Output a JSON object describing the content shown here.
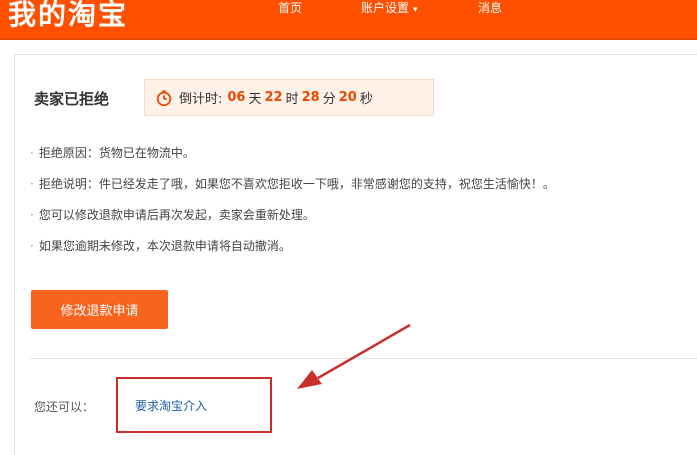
{
  "header": {
    "brand": "我的淘宝",
    "nav": {
      "home": "首页",
      "account": "账户设置",
      "messages": "消息"
    }
  },
  "refund": {
    "status_title": "卖家已拒绝",
    "countdown": {
      "prefix": "倒计时:",
      "days": "06",
      "days_unit": "天",
      "hours": "22",
      "hours_unit": "时",
      "minutes": "28",
      "minutes_unit": "分",
      "seconds": "20",
      "seconds_unit": "秒"
    },
    "details": [
      "拒绝原因：货物已在物流中。",
      "拒绝说明：件已经发走了哦，如果您不喜欢您拒收一下哦，非常感谢您的支持，祝您生活愉快！。",
      "您可以修改退款申请后再次发起，卖家会重新处理。",
      "如果您逾期未修改，本次退款申请将自动撤消。"
    ],
    "modify_button": "修改退款申请",
    "also_label": "您还可以：",
    "intervene_link": "要求淘宝介入"
  },
  "colors": {
    "brand_orange": "#ff5000",
    "button_orange": "#f8641e",
    "highlight_red": "#c9302c",
    "link_blue": "#1f5faa"
  },
  "icons": [
    "clock-icon",
    "chevron-down-icon",
    "arrow-annotation"
  ]
}
